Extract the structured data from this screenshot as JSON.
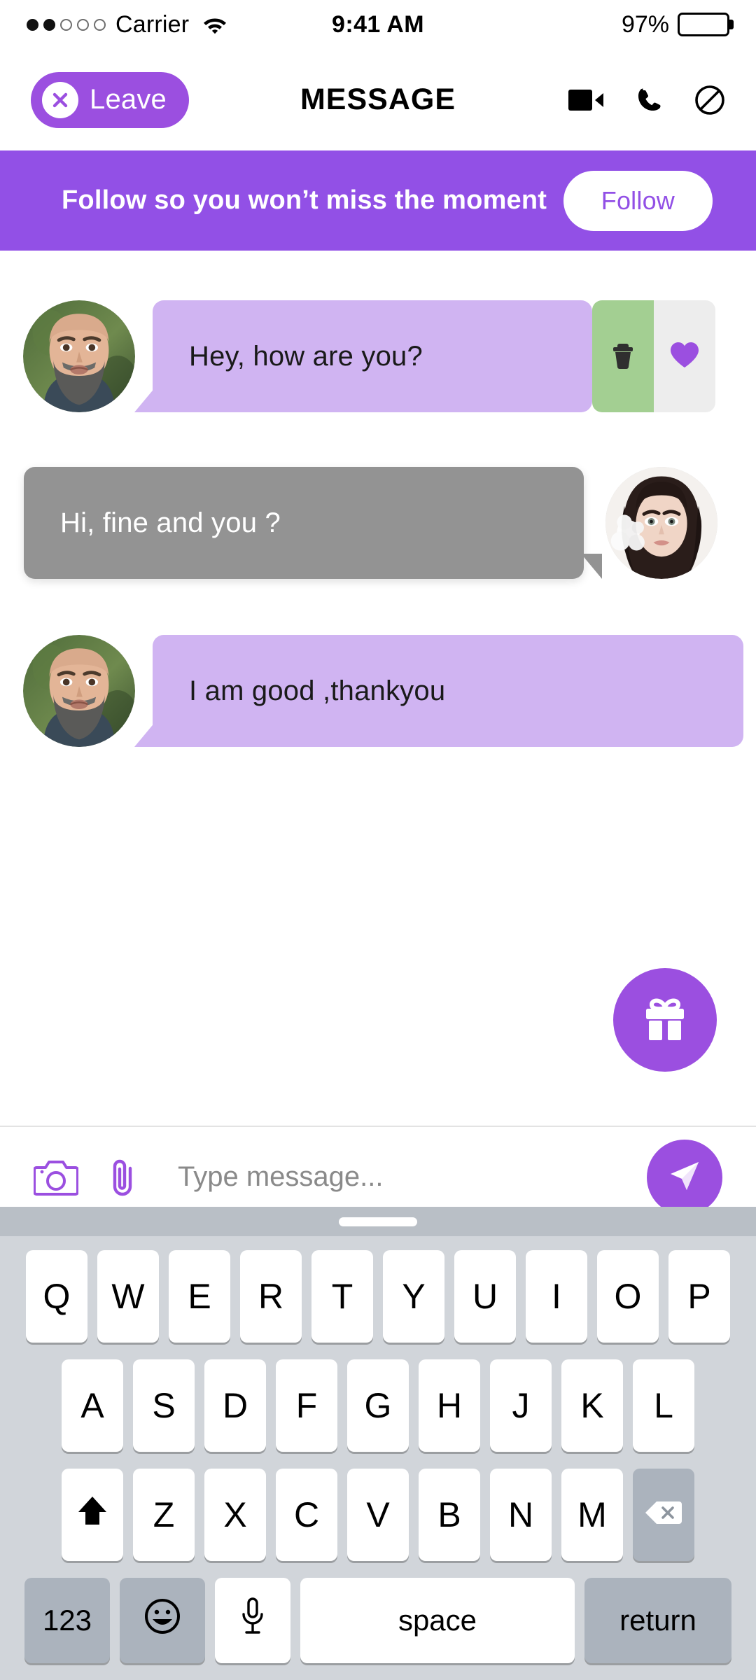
{
  "status_bar": {
    "carrier": "Carrier",
    "signal_dots_filled": 2,
    "signal_dots_total": 5,
    "wifi_icon": "wifi-icon",
    "time": "9:41 AM",
    "battery_percent": "97%",
    "battery_icon": "battery-full-icon"
  },
  "nav_bar": {
    "leave_label": "Leave",
    "leave_icon": "close-circle-icon",
    "title": "MESSAGE",
    "icons": [
      {
        "name": "video-call-icon",
        "label": "Video call"
      },
      {
        "name": "phone-call-icon",
        "label": "Voice call"
      },
      {
        "name": "block-icon",
        "label": "Block"
      }
    ]
  },
  "banner": {
    "text": "Follow so you won’t miss the moment",
    "button_label": "Follow",
    "background_color": "#9250e6",
    "button_text_color": "#9250e6"
  },
  "messages": [
    {
      "id": "msg-1",
      "side": "incoming",
      "text": "Hey, how are you?",
      "avatar": "avatar-bearded-man",
      "bubble_color": "#d0b4f2",
      "text_color": "#1a1a1a",
      "swipe_actions": [
        {
          "name": "delete-action",
          "icon": "trash-icon",
          "background_color": "#a3cf92"
        },
        {
          "name": "like-action",
          "icon": "heart-icon",
          "background_color": "#ededed",
          "icon_color": "#9b4fe0"
        }
      ]
    },
    {
      "id": "msg-2",
      "side": "outgoing",
      "text": "Hi, fine and you ?",
      "avatar": "avatar-dark-haired-woman",
      "bubble_color": "#939393",
      "text_color": "#ffffff"
    },
    {
      "id": "msg-3",
      "side": "incoming",
      "text": "I am good ,thankyou",
      "avatar": "avatar-bearded-man",
      "bubble_color": "#d0b4f2",
      "text_color": "#1a1a1a"
    }
  ],
  "gift_button": {
    "icon": "gift-icon",
    "background_color": "#9b4fe0"
  },
  "input_bar": {
    "camera_icon": "camera-icon",
    "attachment_icon": "paperclip-icon",
    "placeholder": "Type message...",
    "value": "",
    "send_icon": "send-icon",
    "send_background_color": "#9b4fe0",
    "icon_color": "#9b4fe0"
  },
  "keyboard": {
    "handle": "keyboard-drag-handle",
    "row1": [
      "Q",
      "W",
      "E",
      "R",
      "T",
      "Y",
      "U",
      "I",
      "O",
      "P"
    ],
    "row2": [
      "A",
      "S",
      "D",
      "F",
      "G",
      "H",
      "J",
      "K",
      "L"
    ],
    "row3": [
      "Z",
      "X",
      "C",
      "V",
      "B",
      "N",
      "M"
    ],
    "shift_icon": "shift-arrow-icon",
    "backspace_icon": "backspace-icon",
    "numbers_label": "123",
    "emoji_icon": "emoji-smiley-icon",
    "mic_icon": "microphone-icon",
    "space_label": "space",
    "return_label": "return"
  },
  "theme": {
    "accent_purple": "#9b4fe0",
    "banner_purple": "#9250e6",
    "bubble_purple": "#d0b4f2",
    "bubble_gray": "#939393",
    "keyboard_bg": "#d1d5da",
    "key_gray": "#abb3bd"
  }
}
